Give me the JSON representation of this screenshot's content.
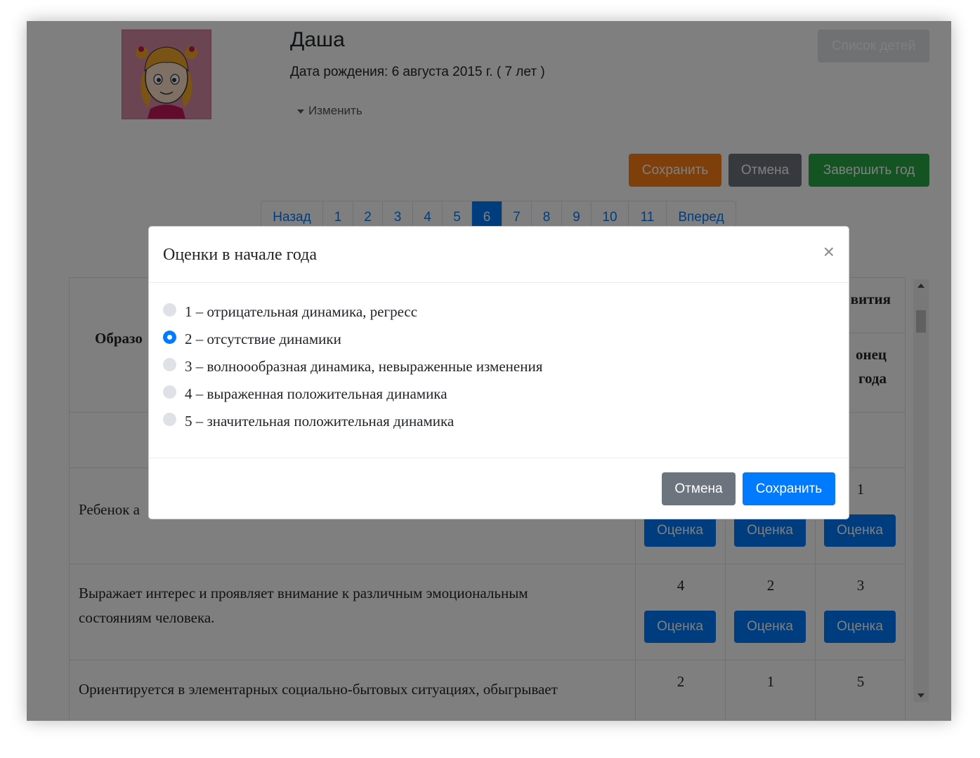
{
  "header": {
    "child_name": "Даша",
    "birth_date": "Дата рождения: 6 августа 2015 г. ( 7 лет )",
    "change_link": "Изменить",
    "children_list_button": "Список детей"
  },
  "actions": {
    "save": "Сохранить",
    "cancel": "Отмена",
    "finish_year": "Завершить год"
  },
  "colors": {
    "primary": "#007bff",
    "warning": "#fd7e14",
    "success": "#28a745",
    "secondary": "#6c757d"
  },
  "pagination": {
    "prev": "Назад",
    "pages": [
      "1",
      "2",
      "3",
      "4",
      "5",
      "6",
      "7",
      "8",
      "9",
      "10",
      "11"
    ],
    "active_page": "6",
    "next": "Вперед"
  },
  "table": {
    "header_partial_left": "Образо",
    "header_partial_right": "вития",
    "subheader_partial_right_1": "онец",
    "subheader_partial_right_2": "года",
    "button_label": "Оценка",
    "rows": [
      {
        "criterion": "Ребенок а",
        "scores": [
          "",
          "",
          "1"
        ]
      },
      {
        "criterion_line1": "Выражает интерес и проявляет внимание к различным эмоциональным",
        "criterion_line2": "состояниям человека.",
        "scores": [
          "4",
          "2",
          "3"
        ]
      },
      {
        "criterion_line1": "Ориентируется в элементарных социально-бытовых ситуациях, обыгрывает",
        "scores": [
          "2",
          "1",
          "5"
        ]
      }
    ]
  },
  "modal": {
    "title": "Оценки в начале года",
    "close_symbol": "×",
    "options": [
      {
        "label": "1 – отрицательная динамика, регресс",
        "checked": false
      },
      {
        "label": "2 – отсутствие динамики",
        "checked": true
      },
      {
        "label": "3 – волноообразная динамика, невыраженные изменения",
        "checked": false
      },
      {
        "label": "4 – выраженная положительная динамика",
        "checked": false
      },
      {
        "label": "5 – значительная положительная динамика",
        "checked": false
      }
    ],
    "cancel": "Отмена",
    "save": "Сохранить"
  }
}
